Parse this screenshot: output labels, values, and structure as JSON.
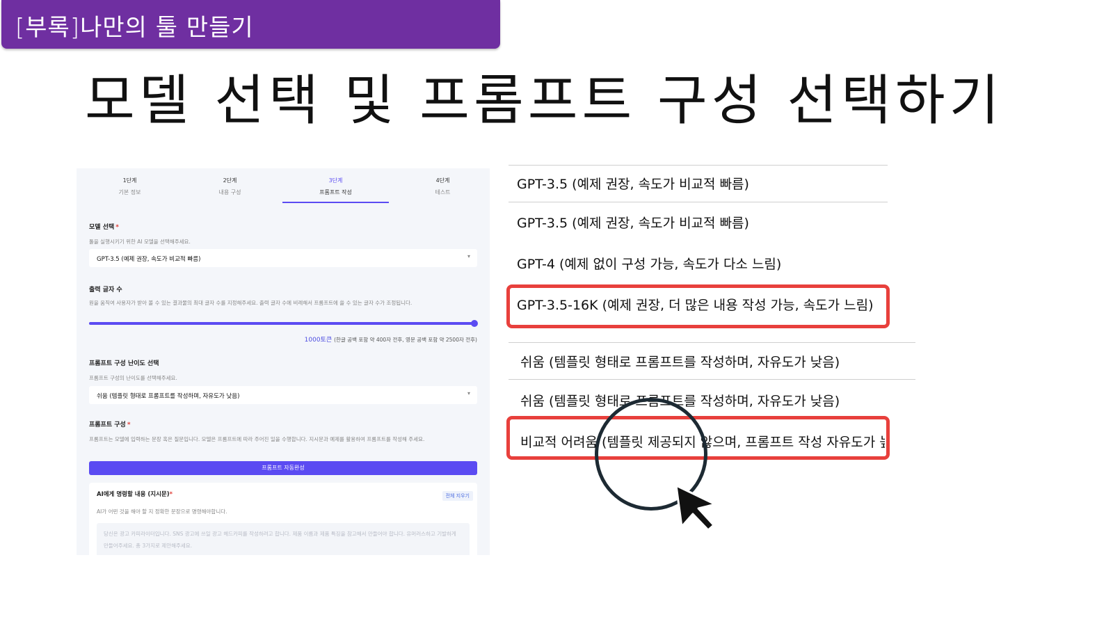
{
  "slide": {
    "tag": "[부록]나만의 툴 만들기",
    "title": "모델 선택 및 프롬프트 구성 선택하기"
  },
  "screenshot": {
    "steps": [
      {
        "num": "1단계",
        "label": "기본 정보"
      },
      {
        "num": "2단계",
        "label": "내용 구성"
      },
      {
        "num": "3단계",
        "label": "프롬프트 작성"
      },
      {
        "num": "4단계",
        "label": "테스트"
      }
    ],
    "model": {
      "label": "모델 선택",
      "required": "*",
      "help": "툴을 실행시키기 위한 AI 모델을 선택해주세요.",
      "selected": "GPT-3.5 (예제 권장, 속도가 비교적 빠름)"
    },
    "output": {
      "label": "출력 글자 수",
      "help": "원을 움직여 사용자가 받아 볼 수 있는 결과물의 최대 글자 수를 지정해주세요. 출력 글자 수에 비례해서 프롬프트에 쓸 수 있는 글자 수가 조정됩니다.",
      "value": "1000토큰",
      "note": "(한글 공백 포함 약 400자 전후, 영문 공백 포함 약 2500자 전후)",
      "slider_level": 1.0
    },
    "difficulty": {
      "label": "프롬프트 구성 난이도 선택",
      "help": "프롬프트 구성의 난이도를 선택해주세요.",
      "selected": "쉬움 (템플릿 형태로 프롬프트를 작성하며, 자유도가 낮음)"
    },
    "prompt": {
      "label": "프롬프트 구성",
      "required": "*",
      "help": "프롬프트는 모델에 입력하는 문장 혹은 질문입니다. 모델은 프롬프트에 따라 주어진 일을 수행합니다. 지시문과 예제를 활용하여 프롬프트를 작성해 주세요.",
      "auto_button": "프롬프트 자동완성"
    },
    "instruction": {
      "title": "AI에게 명령할 내용 (지시문)",
      "required": "*",
      "clear": "전체 지우기",
      "hint": "AI가 어떤 것을 해야 할 지 정확한 문장으로 명령해야합니다.",
      "placeholder": "당신은 광고 카피라이터입니다. SNS 광고에 쓰일 광고 헤드카피를 작성하려고 합니다. 제품 이름과 제품 특징을 참고해서 만들어야 합니다. 유머러스하고 기발하게 만들어주세요. 총 3가지로 제안해주세요."
    }
  },
  "zoom": {
    "model_options": [
      "GPT-3.5 (예제 권장, 속도가 비교적 빠름)",
      "GPT-3.5 (예제 권장, 속도가 비교적 빠름)",
      "GPT-4 (예제 없이 구성 가능, 속도가 다소 느림)",
      "GPT-3.5-16K (예제 권장, 더 많은 내용 작성 가능, 속도가 느림)"
    ],
    "difficulty_options": [
      "쉬움 (템플릿 형태로 프롬프트를 작성하며, 자유도가 낮음)",
      "쉬움 (템플릿 형태로 프롬프트를 작성하며, 자유도가 낮음)",
      "비교적 어려움 (템플릿 제공되지 않으며, 프롬프트 작성 자유도가 높음"
    ]
  },
  "colors": {
    "banner": "#6f2fa1",
    "accent": "#5b4bf2",
    "highlight": "#e8403c"
  },
  "icons": [
    "chevron-down-icon",
    "magnifier-circle-icon",
    "cursor-arrow-icon"
  ]
}
